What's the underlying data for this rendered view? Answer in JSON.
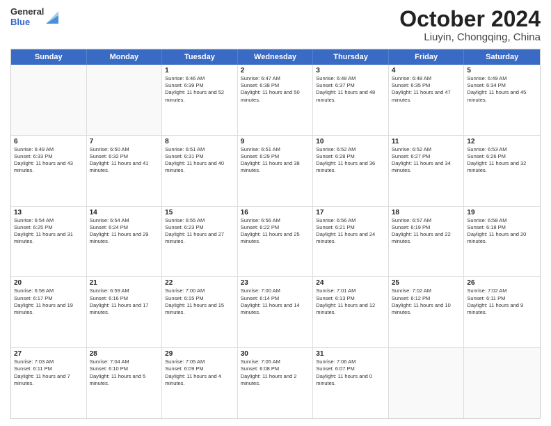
{
  "header": {
    "logo": {
      "line1": "General",
      "line2": "Blue"
    },
    "title": "October 2024",
    "subtitle": "Liuyin, Chongqing, China"
  },
  "calendar": {
    "days": [
      "Sunday",
      "Monday",
      "Tuesday",
      "Wednesday",
      "Thursday",
      "Friday",
      "Saturday"
    ],
    "rows": [
      [
        {
          "day": "",
          "empty": true
        },
        {
          "day": "",
          "empty": true
        },
        {
          "day": "1",
          "sunrise": "Sunrise: 6:46 AM",
          "sunset": "Sunset: 6:39 PM",
          "daylight": "Daylight: 11 hours and 52 minutes."
        },
        {
          "day": "2",
          "sunrise": "Sunrise: 6:47 AM",
          "sunset": "Sunset: 6:38 PM",
          "daylight": "Daylight: 11 hours and 50 minutes."
        },
        {
          "day": "3",
          "sunrise": "Sunrise: 6:48 AM",
          "sunset": "Sunset: 6:37 PM",
          "daylight": "Daylight: 11 hours and 48 minutes."
        },
        {
          "day": "4",
          "sunrise": "Sunrise: 6:48 AM",
          "sunset": "Sunset: 6:35 PM",
          "daylight": "Daylight: 11 hours and 47 minutes."
        },
        {
          "day": "5",
          "sunrise": "Sunrise: 6:49 AM",
          "sunset": "Sunset: 6:34 PM",
          "daylight": "Daylight: 11 hours and 45 minutes."
        }
      ],
      [
        {
          "day": "6",
          "sunrise": "Sunrise: 6:49 AM",
          "sunset": "Sunset: 6:33 PM",
          "daylight": "Daylight: 11 hours and 43 minutes."
        },
        {
          "day": "7",
          "sunrise": "Sunrise: 6:50 AM",
          "sunset": "Sunset: 6:32 PM",
          "daylight": "Daylight: 11 hours and 41 minutes."
        },
        {
          "day": "8",
          "sunrise": "Sunrise: 6:51 AM",
          "sunset": "Sunset: 6:31 PM",
          "daylight": "Daylight: 11 hours and 40 minutes."
        },
        {
          "day": "9",
          "sunrise": "Sunrise: 6:51 AM",
          "sunset": "Sunset: 6:29 PM",
          "daylight": "Daylight: 11 hours and 38 minutes."
        },
        {
          "day": "10",
          "sunrise": "Sunrise: 6:52 AM",
          "sunset": "Sunset: 6:28 PM",
          "daylight": "Daylight: 11 hours and 36 minutes."
        },
        {
          "day": "11",
          "sunrise": "Sunrise: 6:52 AM",
          "sunset": "Sunset: 6:27 PM",
          "daylight": "Daylight: 11 hours and 34 minutes."
        },
        {
          "day": "12",
          "sunrise": "Sunrise: 6:53 AM",
          "sunset": "Sunset: 6:26 PM",
          "daylight": "Daylight: 11 hours and 32 minutes."
        }
      ],
      [
        {
          "day": "13",
          "sunrise": "Sunrise: 6:54 AM",
          "sunset": "Sunset: 6:25 PM",
          "daylight": "Daylight: 11 hours and 31 minutes."
        },
        {
          "day": "14",
          "sunrise": "Sunrise: 6:54 AM",
          "sunset": "Sunset: 6:24 PM",
          "daylight": "Daylight: 11 hours and 29 minutes."
        },
        {
          "day": "15",
          "sunrise": "Sunrise: 6:55 AM",
          "sunset": "Sunset: 6:23 PM",
          "daylight": "Daylight: 11 hours and 27 minutes."
        },
        {
          "day": "16",
          "sunrise": "Sunrise: 6:56 AM",
          "sunset": "Sunset: 6:22 PM",
          "daylight": "Daylight: 11 hours and 25 minutes."
        },
        {
          "day": "17",
          "sunrise": "Sunrise: 6:56 AM",
          "sunset": "Sunset: 6:21 PM",
          "daylight": "Daylight: 11 hours and 24 minutes."
        },
        {
          "day": "18",
          "sunrise": "Sunrise: 6:57 AM",
          "sunset": "Sunset: 6:19 PM",
          "daylight": "Daylight: 11 hours and 22 minutes."
        },
        {
          "day": "19",
          "sunrise": "Sunrise: 6:58 AM",
          "sunset": "Sunset: 6:18 PM",
          "daylight": "Daylight: 11 hours and 20 minutes."
        }
      ],
      [
        {
          "day": "20",
          "sunrise": "Sunrise: 6:58 AM",
          "sunset": "Sunset: 6:17 PM",
          "daylight": "Daylight: 11 hours and 19 minutes."
        },
        {
          "day": "21",
          "sunrise": "Sunrise: 6:59 AM",
          "sunset": "Sunset: 6:16 PM",
          "daylight": "Daylight: 11 hours and 17 minutes."
        },
        {
          "day": "22",
          "sunrise": "Sunrise: 7:00 AM",
          "sunset": "Sunset: 6:15 PM",
          "daylight": "Daylight: 11 hours and 15 minutes."
        },
        {
          "day": "23",
          "sunrise": "Sunrise: 7:00 AM",
          "sunset": "Sunset: 6:14 PM",
          "daylight": "Daylight: 11 hours and 14 minutes."
        },
        {
          "day": "24",
          "sunrise": "Sunrise: 7:01 AM",
          "sunset": "Sunset: 6:13 PM",
          "daylight": "Daylight: 11 hours and 12 minutes."
        },
        {
          "day": "25",
          "sunrise": "Sunrise: 7:02 AM",
          "sunset": "Sunset: 6:12 PM",
          "daylight": "Daylight: 11 hours and 10 minutes."
        },
        {
          "day": "26",
          "sunrise": "Sunrise: 7:02 AM",
          "sunset": "Sunset: 6:11 PM",
          "daylight": "Daylight: 11 hours and 9 minutes."
        }
      ],
      [
        {
          "day": "27",
          "sunrise": "Sunrise: 7:03 AM",
          "sunset": "Sunset: 6:11 PM",
          "daylight": "Daylight: 11 hours and 7 minutes."
        },
        {
          "day": "28",
          "sunrise": "Sunrise: 7:04 AM",
          "sunset": "Sunset: 6:10 PM",
          "daylight": "Daylight: 11 hours and 5 minutes."
        },
        {
          "day": "29",
          "sunrise": "Sunrise: 7:05 AM",
          "sunset": "Sunset: 6:09 PM",
          "daylight": "Daylight: 11 hours and 4 minutes."
        },
        {
          "day": "30",
          "sunrise": "Sunrise: 7:05 AM",
          "sunset": "Sunset: 6:08 PM",
          "daylight": "Daylight: 11 hours and 2 minutes."
        },
        {
          "day": "31",
          "sunrise": "Sunrise: 7:06 AM",
          "sunset": "Sunset: 6:07 PM",
          "daylight": "Daylight: 11 hours and 0 minutes."
        },
        {
          "day": "",
          "empty": true
        },
        {
          "day": "",
          "empty": true
        }
      ]
    ]
  }
}
